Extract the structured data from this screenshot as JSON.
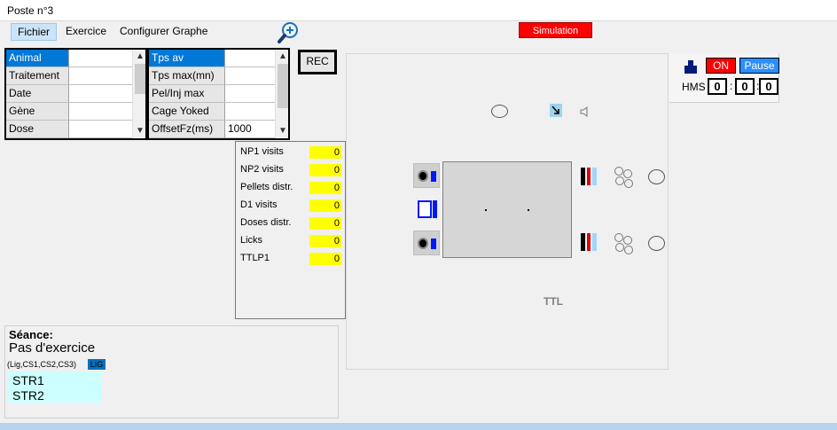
{
  "window": {
    "title": "Poste n°3"
  },
  "menu": {
    "fichier": "Fichier",
    "exercice": "Exercice",
    "configurer": "Configurer Graphe"
  },
  "simulation_label": "Simulation",
  "left_table": {
    "rows": [
      {
        "label": "Animal",
        "value": ""
      },
      {
        "label": "Traitement",
        "value": ""
      },
      {
        "label": "Date",
        "value": ""
      },
      {
        "label": "Gène",
        "value": ""
      },
      {
        "label": "Dose",
        "value": ""
      }
    ]
  },
  "right_table": {
    "rows": [
      {
        "label": "Tps av tout(ms)",
        "value": ""
      },
      {
        "label": "Tps max(mn)",
        "value": ""
      },
      {
        "label": "Pel/Inj max",
        "value": ""
      },
      {
        "label": "Cage Yoked",
        "value": ""
      },
      {
        "label": "OffsetFz(ms)",
        "value": "1000"
      }
    ]
  },
  "rec_label": "REC",
  "counters": [
    {
      "label": "NP1 visits",
      "value": "0"
    },
    {
      "label": "NP2 visits",
      "value": "0"
    },
    {
      "label": "Pellets distr.",
      "value": "0"
    },
    {
      "label": "D1 visits",
      "value": "0"
    },
    {
      "label": "Doses distr.",
      "value": "0"
    },
    {
      "label": "Licks",
      "value": "0"
    },
    {
      "label": "TTLP1",
      "value": "0"
    }
  ],
  "seance": {
    "label": "Séance:",
    "exercise": "Pas d'exercice",
    "params": "(Lig,CS1,CS2,CS3)",
    "lig": "LIG",
    "str1": "STR1",
    "str2": "STR2"
  },
  "arena": {
    "ttl": "TTL"
  },
  "control": {
    "on": "ON",
    "pause": "Pause",
    "hms_label": "HMS",
    "h": "0",
    "m": "0",
    "s": "0",
    "sep": ":"
  },
  "colors": {
    "simulation": "#ff0000",
    "counter_bg": "#ffff00",
    "selected": "#0078d7",
    "pause": "#2b8fff",
    "led_blue": "#0018ff"
  },
  "icons": [
    "zoom-in-icon",
    "cursor-icon",
    "speaker-icon",
    "person-icon"
  ]
}
